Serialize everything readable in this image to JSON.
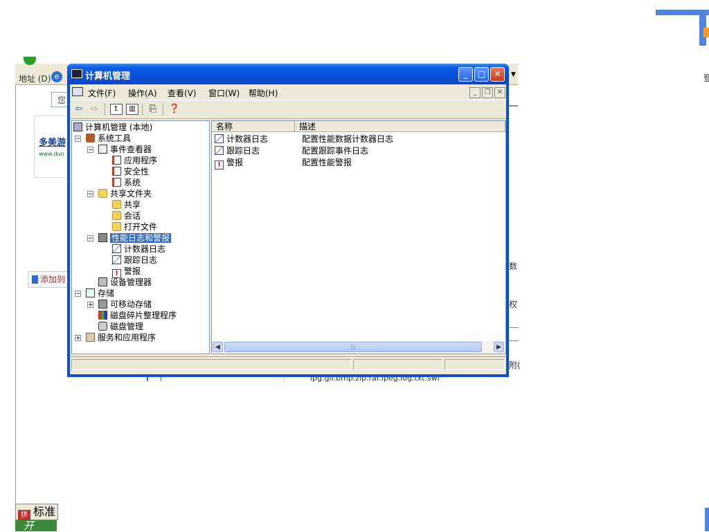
{
  "background": {
    "address_label": "地址 (D)",
    "you_text": "您",
    "card_title": "多美游",
    "card_url": "www.dun",
    "add_button": "添加到",
    "right_text_1": "数",
    "right_text_2": "权",
    "right_text_3": "附(",
    "extensions_text": "ipg.gif.bmp.zip.rar.ipeg.log.txt.swf",
    "taskbar_label": "标准",
    "start_label": "开",
    "edge_text": "登"
  },
  "window": {
    "title": "计算机管理",
    "controls": {
      "minimize": "_",
      "maximize": "□",
      "close": "✕"
    }
  },
  "menubar": {
    "items": [
      {
        "label": "文件(F)"
      },
      {
        "label": "操作(A)"
      },
      {
        "label": "查看(V)"
      },
      {
        "label": "窗口(W)"
      },
      {
        "label": "帮助(H)"
      }
    ]
  },
  "toolbar": {
    "icons": [
      "back-arrow-icon",
      "forward-arrow-icon",
      "up-folder-icon",
      "show-hide-tree-icon",
      "export-list-icon",
      "help-icon"
    ]
  },
  "tree": {
    "root": "计算机管理 (本地)",
    "system_tools": "系统工具",
    "event_viewer": "事件查看器",
    "application": "应用程序",
    "security": "安全性",
    "system": "系统",
    "shared_folders": "共享文件夹",
    "shares": "共享",
    "sessions": "会话",
    "open_files": "打开文件",
    "perf_logs": "性能日志和警报",
    "counter_logs": "计数器日志",
    "trace_logs": "跟踪日志",
    "alerts": "警报",
    "device_manager": "设备管理器",
    "storage": "存储",
    "removable_storage": "可移动存储",
    "disk_defrag": "磁盘碎片整理程序",
    "disk_management": "磁盘管理",
    "services_apps": "服务和应用程序"
  },
  "list": {
    "columns": {
      "name": "名称",
      "description": "描述"
    },
    "rows": [
      {
        "name": "计数器日志",
        "description": "配置性能数据计数器日志"
      },
      {
        "name": "跟踪日志",
        "description": "配置跟踪事件日志"
      },
      {
        "name": "警报",
        "description": "配置性能警报"
      }
    ]
  }
}
